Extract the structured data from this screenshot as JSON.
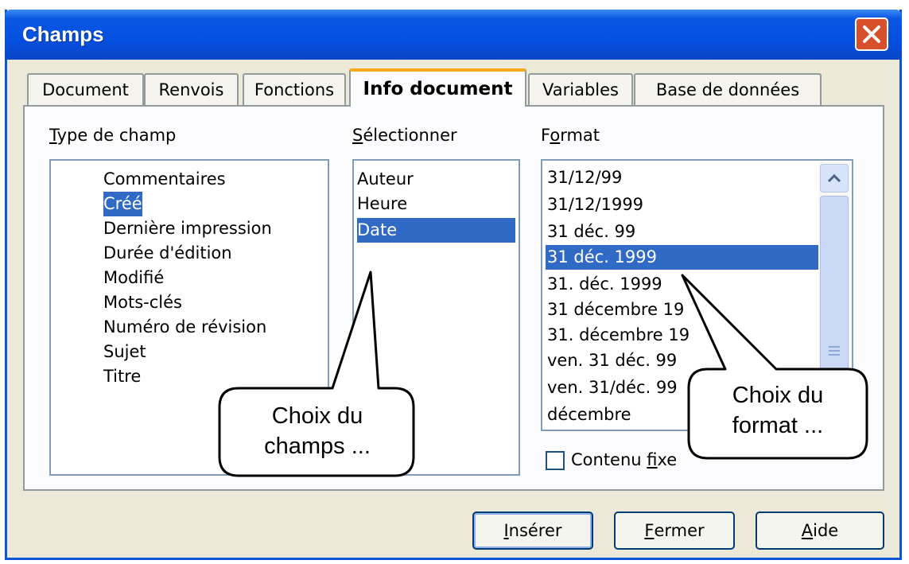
{
  "window": {
    "title": "Champs"
  },
  "tabs": [
    {
      "label": "Document",
      "active": false
    },
    {
      "label": "Renvois",
      "active": false
    },
    {
      "label": "Fonctions",
      "active": false
    },
    {
      "label": "Info document",
      "active": true
    },
    {
      "label": "Variables",
      "active": false
    },
    {
      "label": "Base de données",
      "active": false
    }
  ],
  "type_de_champ": {
    "label_first": "T",
    "label_rest": "ype de champ",
    "items": [
      "Commentaires",
      "Créé",
      "Dernière impression",
      "Durée d'édition",
      "Modifié",
      "Mots-clés",
      "Numéro de révision",
      "Sujet",
      "Titre"
    ],
    "selected": "Créé"
  },
  "selectionner": {
    "label_first": "S",
    "label_rest": "électionner",
    "items": [
      "Auteur",
      "Heure",
      "Date"
    ],
    "selected": "Date"
  },
  "format": {
    "label_pre": "F",
    "label_u": "o",
    "label_rest": "rmat",
    "items": [
      "31/12/99",
      "31/12/1999",
      "31 déc. 99",
      "31 déc. 1999",
      "31. déc. 1999",
      "31 décembre 19",
      "31. décembre 19",
      "ven. 31 déc. 99",
      "ven. 31/déc. 99",
      "décembre"
    ],
    "selected": "31 déc. 1999"
  },
  "contenu_fixe": {
    "pre": "Contenu ",
    "u": "f",
    "rest": "ixe",
    "checked": false
  },
  "buttons": {
    "inserer": {
      "u": "I",
      "rest": "nsérer"
    },
    "fermer": {
      "u": "F",
      "rest": "ermer"
    },
    "aide": {
      "u": "A",
      "rest": "ide"
    }
  },
  "callouts": {
    "champs": {
      "line1": "Choix du",
      "line2": "champs ..."
    },
    "format": {
      "line1": "Choix du",
      "line2": "format ..."
    }
  },
  "colors": {
    "selection": "#316ac5",
    "titlebar": "#0450e0",
    "tab_accent": "#f7a91d",
    "close": "#d8502b"
  }
}
